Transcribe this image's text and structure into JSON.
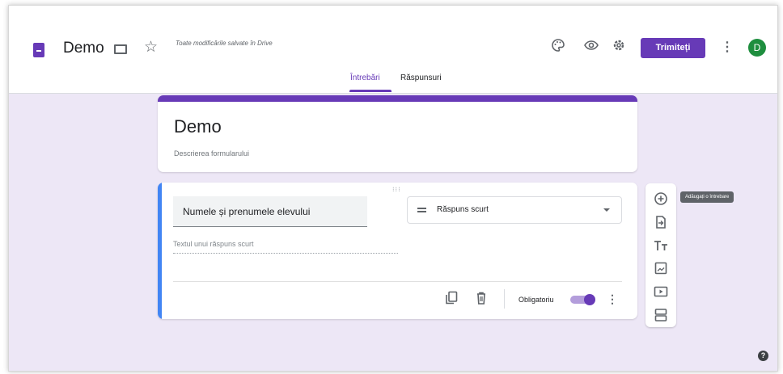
{
  "header": {
    "title": "Demo",
    "save_status": "Toate modificările salvate în Drive",
    "send_label": "Trimiteți",
    "avatar_letter": "D"
  },
  "tabs": [
    {
      "label": "Întrebări",
      "active": true
    },
    {
      "label": "Răspunsuri",
      "active": false
    }
  ],
  "form": {
    "title": "Demo",
    "description": "Descrierea formularului"
  },
  "question": {
    "title": "Numele și prenumele elevului",
    "type": "Răspuns scurt",
    "answer_placeholder": "Textul unui răspuns scurt",
    "required_label": "Obligatoriu",
    "required": true
  },
  "tooltip": "Adăugați o întrebare",
  "icons": {
    "header": [
      "form-doc-icon",
      "folder-icon",
      "star-icon",
      "palette-icon",
      "preview-eye-icon",
      "settings-gear-icon",
      "more-vert-icon"
    ],
    "question": [
      "drag-handle-icon",
      "short-answer-icon",
      "dropdown-caret-icon",
      "duplicate-icon",
      "delete-icon",
      "more-vert-icon"
    ],
    "sidebar": [
      "add-question-icon",
      "import-questions-icon",
      "add-title-icon",
      "add-image-icon",
      "add-video-icon",
      "add-section-icon"
    ],
    "footer": [
      "help-icon"
    ]
  },
  "colors": {
    "accent": "#673ab7",
    "question_bar": "#4285f4",
    "canvas_bg": "#ede7f6",
    "avatar_bg": "#1e8e3e"
  }
}
